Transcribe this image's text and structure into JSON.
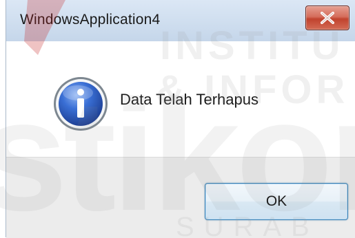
{
  "window": {
    "title": "WindowsApplication4",
    "close_icon": "close-icon"
  },
  "message": {
    "icon": "info-icon",
    "text": "Data Telah Terhapus"
  },
  "buttons": {
    "ok_label": "OK"
  },
  "watermark": {
    "lines": [
      "INSTITU",
      "& INFOR",
      "stikom",
      "SURAB"
    ]
  },
  "colors": {
    "titlebar": "#cfdeef",
    "close_button": "#c1432e",
    "info_icon": "#2f63c9",
    "ok_border": "#3c7fb1",
    "footer": "#ececec"
  }
}
